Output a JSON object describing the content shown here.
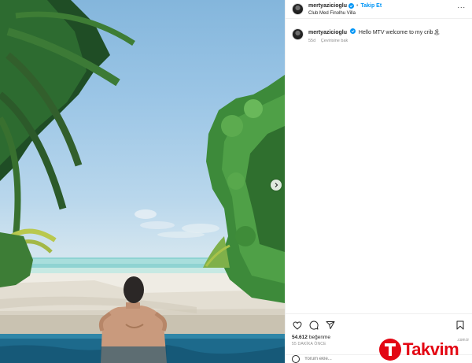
{
  "post": {
    "username": "mertyazicioglu",
    "follow_label": "Takip Et",
    "separator": "•",
    "location": "Club Med Finolhu Villa",
    "more_label": "...",
    "caption_user": "mertyazicioglu",
    "caption_text": "Hello MTV welcome to my crib🏝",
    "caption_age": "55d",
    "translate_label": "Çevirisine bak",
    "likes_count": "54.612",
    "likes_label": "beğenme",
    "timestamp": "55 DAKİKA ÖNCE",
    "comment_placeholder": "Yorum ekle..."
  },
  "icons": {
    "verified": "verified-badge-icon",
    "like": "heart-icon",
    "comment": "comment-bubble-icon",
    "share": "paper-plane-icon",
    "save": "bookmark-icon",
    "emoji": "emoji-icon",
    "next": "chevron-right-icon"
  },
  "watermark": {
    "text": "Takvim",
    "sub": ".com.tr"
  },
  "colors": {
    "accent": "#0095f6",
    "watermark": "#e30613"
  }
}
